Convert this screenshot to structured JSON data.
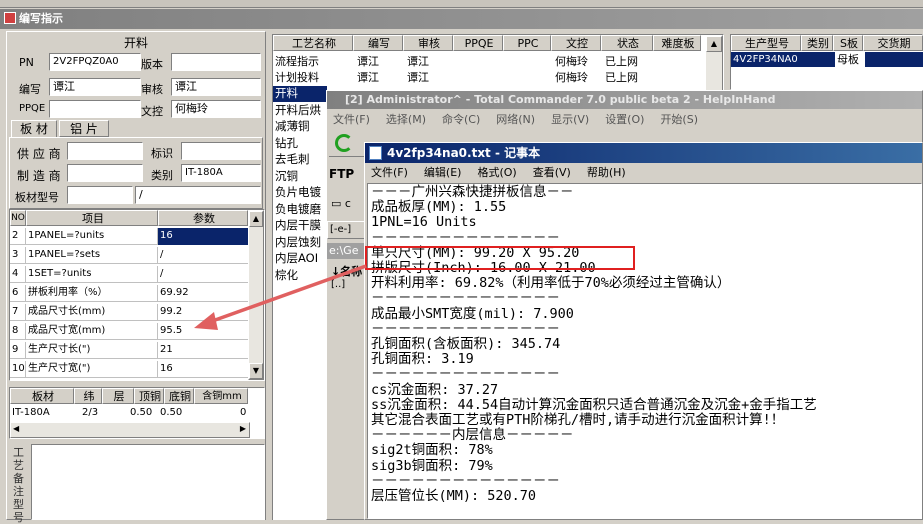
{
  "main": {
    "title": "编写指示"
  },
  "form": {
    "section_title": "开料",
    "pn_label": "PN",
    "pn_value": "2V2FPQZ0A0",
    "version_label": "版本",
    "author_label": "编写",
    "author_value": "谭江",
    "review_label": "审核",
    "review_value": "谭江",
    "ppqe_label": "PPQE",
    "doc_label": "文控",
    "doc_value": "何梅玲",
    "tabs": [
      "板 材",
      "铝 片"
    ],
    "supplier_label": "供 应 商",
    "mark_label": "标识",
    "maker_label": "制 造 商",
    "category_label": "类别",
    "category_value": "IT-180A",
    "model_label": "板材型号",
    "model_value": "/"
  },
  "param_table": {
    "headers": [
      "NO",
      "项目",
      "参数"
    ],
    "rows": [
      {
        "no": "2",
        "item": "1PANEL=?units",
        "value": "16"
      },
      {
        "no": "3",
        "item": "1PANEL=?sets",
        "value": "/"
      },
      {
        "no": "4",
        "item": "1SET=?units",
        "value": "/"
      },
      {
        "no": "6",
        "item": "拼板利用率（%）",
        "value": "69.92"
      },
      {
        "no": "7",
        "item": "成品尺寸长(mm)",
        "value": "99.2"
      },
      {
        "no": "8",
        "item": "成品尺寸宽(mm)",
        "value": "95.5"
      },
      {
        "no": "9",
        "item": "生产尺寸长(\")",
        "value": "21"
      },
      {
        "no": "10",
        "item": "生产尺寸宽(\")",
        "value": "16"
      }
    ]
  },
  "material_table": {
    "headers": [
      "板材",
      "纬",
      "层",
      "顶铜",
      "底铜",
      "含铜mm"
    ],
    "row": [
      "IT-180A",
      "2/3",
      "0.50",
      "0.50",
      "0"
    ]
  },
  "side_label": "工艺备注型号",
  "process_table": {
    "headers": [
      "工艺名称",
      "编写",
      "审核",
      "PPQE",
      "PPC",
      "文控",
      "状态",
      "难度板"
    ],
    "rows": [
      [
        "流程指示",
        "谭江",
        "谭江",
        "",
        "",
        "何梅玲",
        "已上网",
        ""
      ],
      [
        "计划投料",
        "谭江",
        "谭江",
        "",
        "",
        "何梅玲",
        "已上网",
        ""
      ]
    ],
    "list": [
      "开料",
      "开料后烘",
      "减薄铜",
      "钻孔",
      "去毛刺",
      "沉铜",
      "负片电镀",
      "负电镀磨",
      "内层干膜",
      "内层蚀刻",
      "内层AOI",
      "棕化"
    ]
  },
  "order_table": {
    "headers": [
      "生产型号",
      "类别",
      "S板",
      "交货期"
    ],
    "row": [
      "4V2FP34NA0",
      "",
      "母板",
      ""
    ]
  },
  "tc": {
    "title": "[2] Administrator^ - Total Commander 7.0 public beta 2 - HelpInHand",
    "menu": [
      "文件(F)",
      "选择(M)",
      "命令(C)",
      "网络(N)",
      "显示(V)",
      "设置(O)",
      "开始(S)"
    ],
    "ftp_label": "FTP",
    "drive_label": "[-e-]",
    "path_label": "e:\\Ge",
    "name_col": "↓名称",
    "drive_c": "c",
    "item_label": "[..]"
  },
  "notepad": {
    "title": "4v2fp34na0.txt - 记事本",
    "menu": [
      "文件(F)",
      "编辑(E)",
      "格式(O)",
      "查看(V)",
      "帮助(H)"
    ],
    "lines": [
      "－－－广州兴森快捷拼板信息－－",
      "成品板厚(MM): 1.55",
      "1PNL=16 Units",
      "－－－－－－－－－－－－－－",
      "单只尺寸(MM): 99.20 X 95.20",
      "拼版尺寸(Inch): 16.00 X 21.00",
      "开料利用率: 69.82%（利用率低于70%必须经过主管确认）",
      "－－－－－－－－－－－－－－",
      "成品最小SMT宽度(mil): 7.900",
      "－－－－－－－－－－－－－－",
      "孔铜面积(含板面积): 345.74",
      "孔铜面积: 3.19",
      "－－－－－－－－－－－－－－",
      "cs沉金面积: 37.27",
      "ss沉金面积: 44.54自动计算沉金面积只适合普通沉金及沉金+金手指工艺",
      "其它混合表面工艺或有PTH阶梯孔/槽时,请手动进行沉金面积计算!！",
      "－－－－－－内层信息－－－－－",
      "sig2t铜面积: 78%",
      "sig3b铜面积: 79%",
      "－－－－－－－－－－－－－－",
      "层压管位长(MM): 520.70"
    ]
  },
  "colors": {
    "title_bar": "#0a246a",
    "selection": "#0a246a",
    "highlight_box": "#e02020",
    "arrow": "#e06060"
  }
}
